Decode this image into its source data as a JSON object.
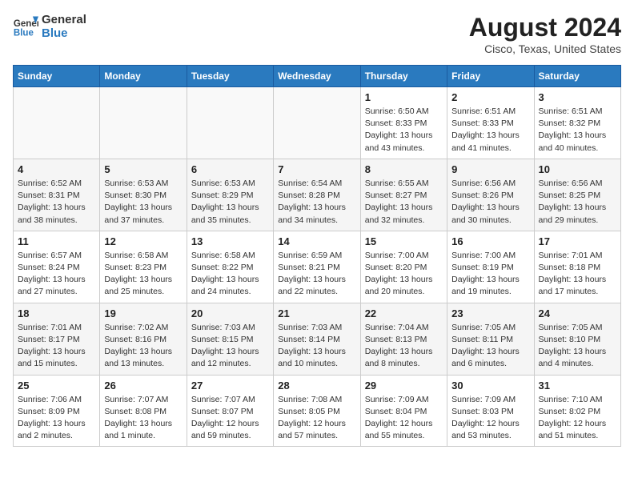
{
  "header": {
    "logo_line1": "General",
    "logo_line2": "Blue",
    "title": "August 2024",
    "subtitle": "Cisco, Texas, United States"
  },
  "weekdays": [
    "Sunday",
    "Monday",
    "Tuesday",
    "Wednesday",
    "Thursday",
    "Friday",
    "Saturday"
  ],
  "weeks": [
    [
      {
        "day": "",
        "detail": ""
      },
      {
        "day": "",
        "detail": ""
      },
      {
        "day": "",
        "detail": ""
      },
      {
        "day": "",
        "detail": ""
      },
      {
        "day": "1",
        "detail": "Sunrise: 6:50 AM\nSunset: 8:33 PM\nDaylight: 13 hours\nand 43 minutes."
      },
      {
        "day": "2",
        "detail": "Sunrise: 6:51 AM\nSunset: 8:33 PM\nDaylight: 13 hours\nand 41 minutes."
      },
      {
        "day": "3",
        "detail": "Sunrise: 6:51 AM\nSunset: 8:32 PM\nDaylight: 13 hours\nand 40 minutes."
      }
    ],
    [
      {
        "day": "4",
        "detail": "Sunrise: 6:52 AM\nSunset: 8:31 PM\nDaylight: 13 hours\nand 38 minutes."
      },
      {
        "day": "5",
        "detail": "Sunrise: 6:53 AM\nSunset: 8:30 PM\nDaylight: 13 hours\nand 37 minutes."
      },
      {
        "day": "6",
        "detail": "Sunrise: 6:53 AM\nSunset: 8:29 PM\nDaylight: 13 hours\nand 35 minutes."
      },
      {
        "day": "7",
        "detail": "Sunrise: 6:54 AM\nSunset: 8:28 PM\nDaylight: 13 hours\nand 34 minutes."
      },
      {
        "day": "8",
        "detail": "Sunrise: 6:55 AM\nSunset: 8:27 PM\nDaylight: 13 hours\nand 32 minutes."
      },
      {
        "day": "9",
        "detail": "Sunrise: 6:56 AM\nSunset: 8:26 PM\nDaylight: 13 hours\nand 30 minutes."
      },
      {
        "day": "10",
        "detail": "Sunrise: 6:56 AM\nSunset: 8:25 PM\nDaylight: 13 hours\nand 29 minutes."
      }
    ],
    [
      {
        "day": "11",
        "detail": "Sunrise: 6:57 AM\nSunset: 8:24 PM\nDaylight: 13 hours\nand 27 minutes."
      },
      {
        "day": "12",
        "detail": "Sunrise: 6:58 AM\nSunset: 8:23 PM\nDaylight: 13 hours\nand 25 minutes."
      },
      {
        "day": "13",
        "detail": "Sunrise: 6:58 AM\nSunset: 8:22 PM\nDaylight: 13 hours\nand 24 minutes."
      },
      {
        "day": "14",
        "detail": "Sunrise: 6:59 AM\nSunset: 8:21 PM\nDaylight: 13 hours\nand 22 minutes."
      },
      {
        "day": "15",
        "detail": "Sunrise: 7:00 AM\nSunset: 8:20 PM\nDaylight: 13 hours\nand 20 minutes."
      },
      {
        "day": "16",
        "detail": "Sunrise: 7:00 AM\nSunset: 8:19 PM\nDaylight: 13 hours\nand 19 minutes."
      },
      {
        "day": "17",
        "detail": "Sunrise: 7:01 AM\nSunset: 8:18 PM\nDaylight: 13 hours\nand 17 minutes."
      }
    ],
    [
      {
        "day": "18",
        "detail": "Sunrise: 7:01 AM\nSunset: 8:17 PM\nDaylight: 13 hours\nand 15 minutes."
      },
      {
        "day": "19",
        "detail": "Sunrise: 7:02 AM\nSunset: 8:16 PM\nDaylight: 13 hours\nand 13 minutes."
      },
      {
        "day": "20",
        "detail": "Sunrise: 7:03 AM\nSunset: 8:15 PM\nDaylight: 13 hours\nand 12 minutes."
      },
      {
        "day": "21",
        "detail": "Sunrise: 7:03 AM\nSunset: 8:14 PM\nDaylight: 13 hours\nand 10 minutes."
      },
      {
        "day": "22",
        "detail": "Sunrise: 7:04 AM\nSunset: 8:13 PM\nDaylight: 13 hours\nand 8 minutes."
      },
      {
        "day": "23",
        "detail": "Sunrise: 7:05 AM\nSunset: 8:11 PM\nDaylight: 13 hours\nand 6 minutes."
      },
      {
        "day": "24",
        "detail": "Sunrise: 7:05 AM\nSunset: 8:10 PM\nDaylight: 13 hours\nand 4 minutes."
      }
    ],
    [
      {
        "day": "25",
        "detail": "Sunrise: 7:06 AM\nSunset: 8:09 PM\nDaylight: 13 hours\nand 2 minutes."
      },
      {
        "day": "26",
        "detail": "Sunrise: 7:07 AM\nSunset: 8:08 PM\nDaylight: 13 hours\nand 1 minute."
      },
      {
        "day": "27",
        "detail": "Sunrise: 7:07 AM\nSunset: 8:07 PM\nDaylight: 12 hours\nand 59 minutes."
      },
      {
        "day": "28",
        "detail": "Sunrise: 7:08 AM\nSunset: 8:05 PM\nDaylight: 12 hours\nand 57 minutes."
      },
      {
        "day": "29",
        "detail": "Sunrise: 7:09 AM\nSunset: 8:04 PM\nDaylight: 12 hours\nand 55 minutes."
      },
      {
        "day": "30",
        "detail": "Sunrise: 7:09 AM\nSunset: 8:03 PM\nDaylight: 12 hours\nand 53 minutes."
      },
      {
        "day": "31",
        "detail": "Sunrise: 7:10 AM\nSunset: 8:02 PM\nDaylight: 12 hours\nand 51 minutes."
      }
    ]
  ]
}
